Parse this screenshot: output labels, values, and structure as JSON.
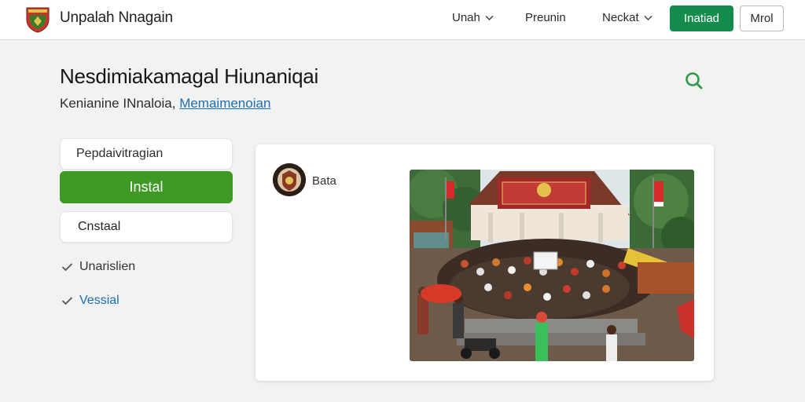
{
  "header": {
    "brand": "Unpalah Nnagain",
    "nav": [
      "Unah",
      "Preunin",
      "Neckat"
    ],
    "primary_button": "Inatiad",
    "secondary_button": "Mrol"
  },
  "main": {
    "title": "Nesdimiakamagal Hiunaniqai",
    "subtitle_text": "Kenianine INnaloia,",
    "subtitle_link": "Memaimenoian"
  },
  "sidebar": {
    "input_label": "Pepdaivitragian",
    "green_button": "Instal",
    "outline_button": "Cnstaal",
    "checks": [
      {
        "label": "Unarislien",
        "style": "muted"
      },
      {
        "label": "Vessial",
        "style": "link"
      }
    ]
  },
  "post": {
    "author": "Bata"
  },
  "icons": {
    "search": "search-icon",
    "chevron": "chevron-down-icon",
    "check": "check-icon",
    "logo": "shield-logo"
  },
  "colors": {
    "primary_green": "#148c4b",
    "sidebar_green": "#3e9a25",
    "link_blue": "#1a6fb5",
    "search_green": "#2e9b46"
  }
}
